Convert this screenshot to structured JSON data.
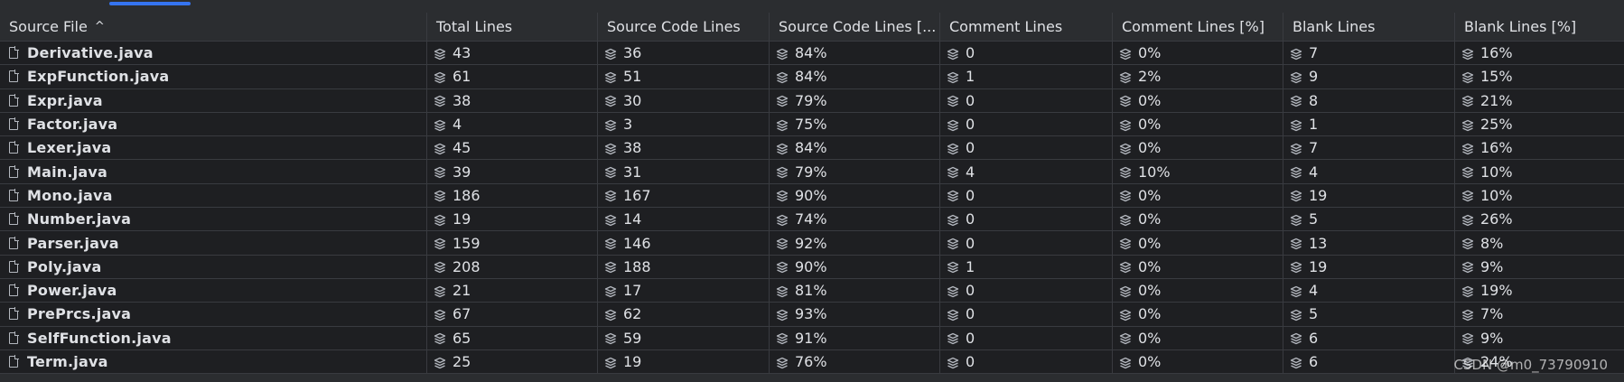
{
  "columns": [
    "Source File",
    "Total Lines",
    "Source Code Lines",
    "Source Code Lines [...",
    "Comment Lines",
    "Comment Lines [%]",
    "Blank Lines",
    "Blank Lines [%]"
  ],
  "sort": {
    "column": "Source File",
    "direction": "ascending",
    "icon": "chevron-up-icon"
  },
  "rows": [
    [
      "Derivative.java",
      "43",
      "36",
      "84%",
      "0",
      "0%",
      "7",
      "16%"
    ],
    [
      "ExpFunction.java",
      "61",
      "51",
      "84%",
      "1",
      "2%",
      "9",
      "15%"
    ],
    [
      "Expr.java",
      "38",
      "30",
      "79%",
      "0",
      "0%",
      "8",
      "21%"
    ],
    [
      "Factor.java",
      "4",
      "3",
      "75%",
      "0",
      "0%",
      "1",
      "25%"
    ],
    [
      "Lexer.java",
      "45",
      "38",
      "84%",
      "0",
      "0%",
      "7",
      "16%"
    ],
    [
      "Main.java",
      "39",
      "31",
      "79%",
      "4",
      "10%",
      "4",
      "10%"
    ],
    [
      "Mono.java",
      "186",
      "167",
      "90%",
      "0",
      "0%",
      "19",
      "10%"
    ],
    [
      "Number.java",
      "19",
      "14",
      "74%",
      "0",
      "0%",
      "5",
      "26%"
    ],
    [
      "Parser.java",
      "159",
      "146",
      "92%",
      "0",
      "0%",
      "13",
      "8%"
    ],
    [
      "Poly.java",
      "208",
      "188",
      "90%",
      "1",
      "0%",
      "19",
      "9%"
    ],
    [
      "Power.java",
      "21",
      "17",
      "81%",
      "0",
      "0%",
      "4",
      "19%"
    ],
    [
      "PrePrcs.java",
      "67",
      "62",
      "93%",
      "0",
      "0%",
      "5",
      "7%"
    ],
    [
      "SelfFunction.java",
      "65",
      "59",
      "91%",
      "0",
      "0%",
      "6",
      "9%"
    ],
    [
      "Term.java",
      "25",
      "19",
      "76%",
      "0",
      "0%",
      "6",
      "24%"
    ]
  ],
  "watermark": "CSDN @m0_73790910",
  "colors": {
    "background": "#1e1f22",
    "header_background": "#2b2d30",
    "grid_line": "#393b40",
    "text": "#dfe1e5",
    "accent": "#3574f0"
  },
  "icons": {
    "file": "file-icon",
    "metric": "stack-icon"
  }
}
